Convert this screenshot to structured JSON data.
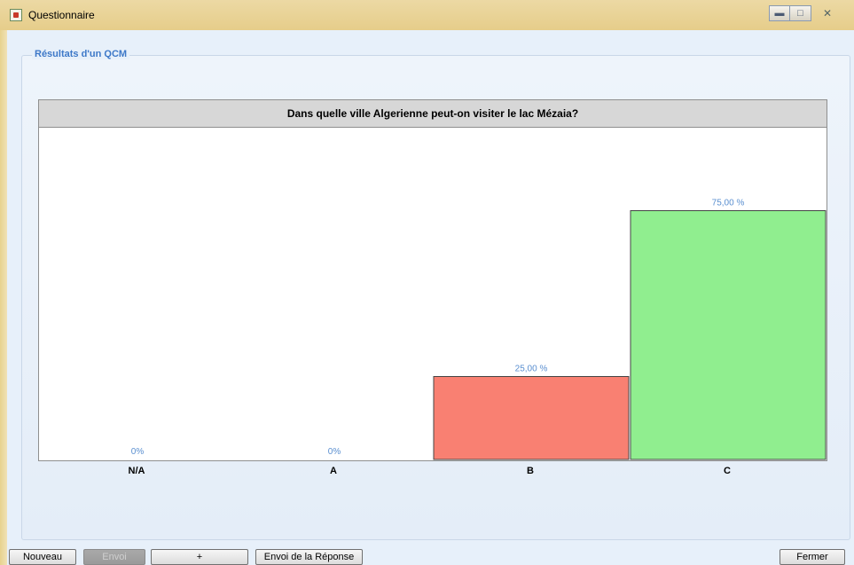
{
  "window": {
    "title": "Questionnaire"
  },
  "group": {
    "legend": "Résultats d'un QCM"
  },
  "chart_data": {
    "type": "bar",
    "title": "Dans quelle ville Algerienne peut-on visiter le lac Mézaia?",
    "categories": [
      "N/A",
      "A",
      "B",
      "C"
    ],
    "values": [
      0,
      0,
      25,
      75
    ],
    "value_labels": [
      "0%",
      "0%",
      "25,00 %",
      "75,00 %"
    ],
    "colors": [
      "#f08070",
      "#f08070",
      "#f98072",
      "#90ee8f"
    ],
    "ylim": [
      0,
      100
    ]
  },
  "buttons": {
    "nouveau": "Nouveau",
    "envoi": "Envoi",
    "plus": "+",
    "envoi_reponse": "Envoi de la Réponse",
    "fermer": "Fermer"
  }
}
